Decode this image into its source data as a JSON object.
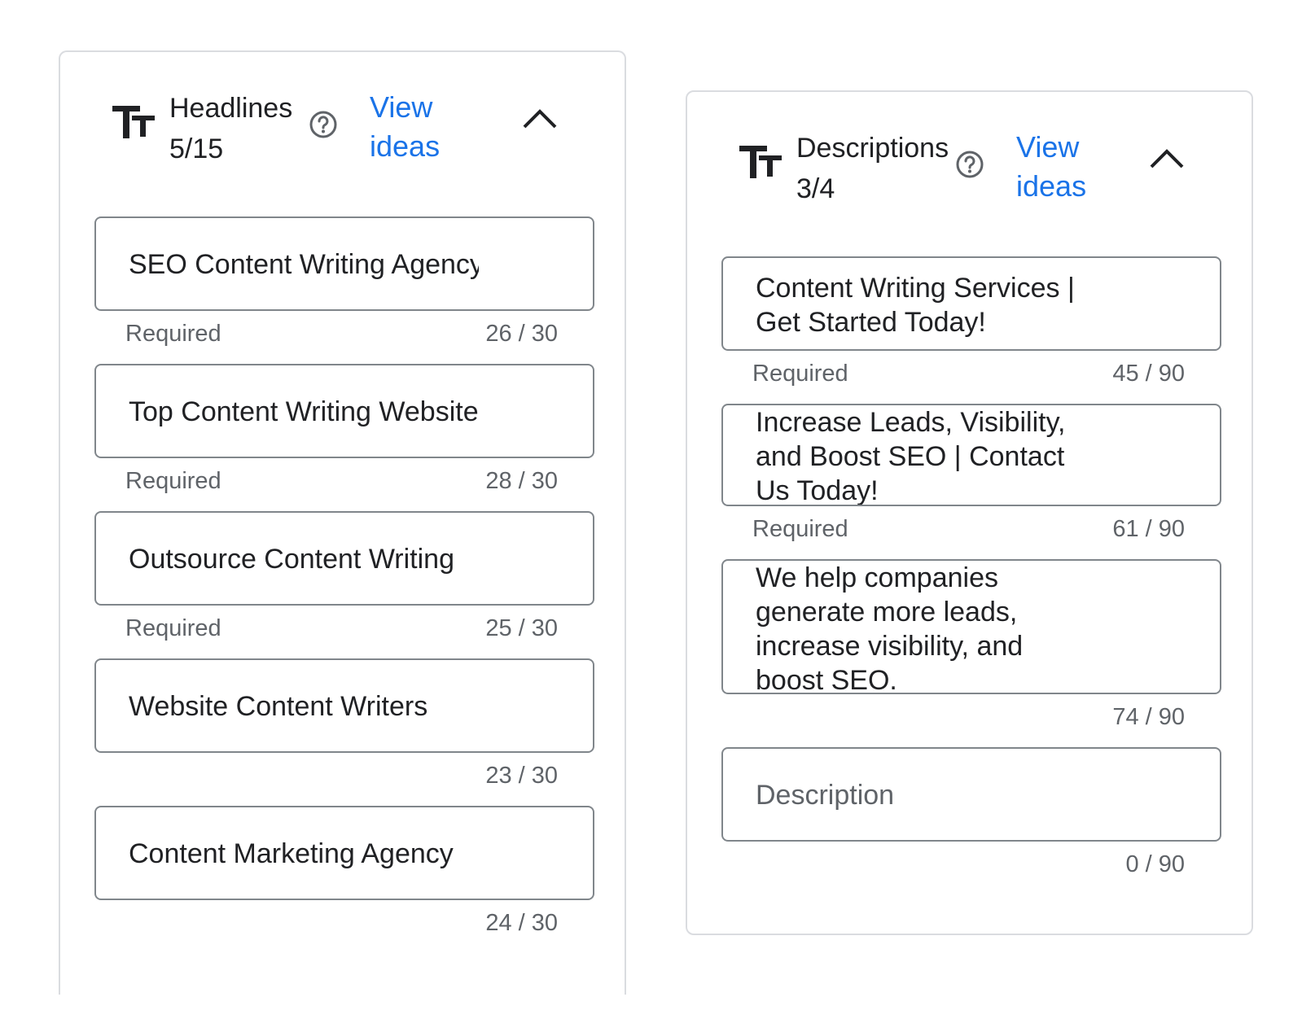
{
  "headlines": {
    "title": "Headlines",
    "count": "5/15",
    "view_ideas": "View ideas",
    "fields": [
      {
        "value": "SEO Content Writing Agency",
        "helper": "Required",
        "counter": "26 / 30"
      },
      {
        "value": "Top Content Writing Website",
        "helper": "Required",
        "counter": "28 / 30"
      },
      {
        "value": "Outsource Content Writing",
        "helper": "Required",
        "counter": "25 / 30"
      },
      {
        "value": "Website Content Writers",
        "helper": "",
        "counter": "23 / 30"
      },
      {
        "value": "Content Marketing Agency",
        "helper": "",
        "counter": "24 / 30"
      }
    ]
  },
  "descriptions": {
    "title": "Descriptions",
    "count": "3/4",
    "view_ideas": "View ideas",
    "fields": [
      {
        "value": "Content Writing Services |\nGet Started Today!",
        "helper": "Required",
        "counter": "45 / 90"
      },
      {
        "value": "Increase Leads, Visibility,\nand Boost SEO | Contact\nUs Today!",
        "helper": "Required",
        "counter": "61 / 90"
      },
      {
        "value": "We help companies\ngenerate more leads,\nincrease visibility, and\nboost SEO.",
        "helper": "",
        "counter": "74 / 90"
      },
      {
        "value": "",
        "placeholder": "Description",
        "helper": "",
        "counter": "0 / 90"
      }
    ]
  },
  "icons": {
    "text_type": "tt-icon",
    "help": "help-circle-icon",
    "collapse": "chevron-up-icon"
  },
  "colors": {
    "link": "#1a73e8",
    "border": "#80868b",
    "panel_border": "#dadce0",
    "secondary_text": "#5f6368"
  }
}
